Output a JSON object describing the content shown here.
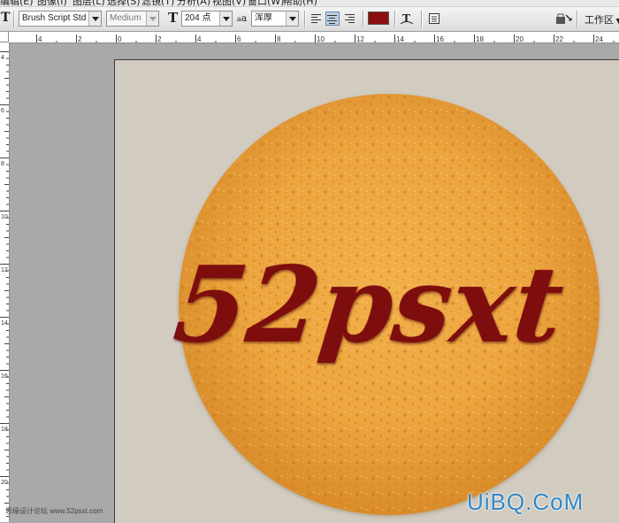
{
  "menubar": {
    "items": [
      "编辑(E)",
      "图像(I)",
      "图层(L)",
      "选择(S)",
      "滤镜(T)",
      "分析(A)",
      "视图(V)",
      "窗口(W)",
      "帮助(H)"
    ]
  },
  "options_bar": {
    "tool_glyph": "T",
    "font_family": "Brush Script Std",
    "font_style": "Medium",
    "size_glyph": "T",
    "font_size": "204 点",
    "aa_glyph": "a",
    "anti_alias": "浑厚",
    "text_color": "#8b0d0d",
    "workspace_label": "工作区"
  },
  "ruler": {
    "top_numbers": [
      "4",
      "2",
      "0",
      "2",
      "4",
      "6",
      "8",
      "10",
      "12",
      "14",
      "16",
      "18",
      "20",
      "22",
      "24"
    ],
    "left_numbers": [
      "4",
      "6",
      "8",
      "10",
      "12",
      "14",
      "16",
      "18",
      "20"
    ]
  },
  "canvas": {
    "headline": "52psxt",
    "headline_color": "#7e0c10",
    "background": "#d2cbc0"
  },
  "watermarks": {
    "left": "思缘设计论坛 www.52psxt.com",
    "right": "UiBQ.CoM"
  }
}
